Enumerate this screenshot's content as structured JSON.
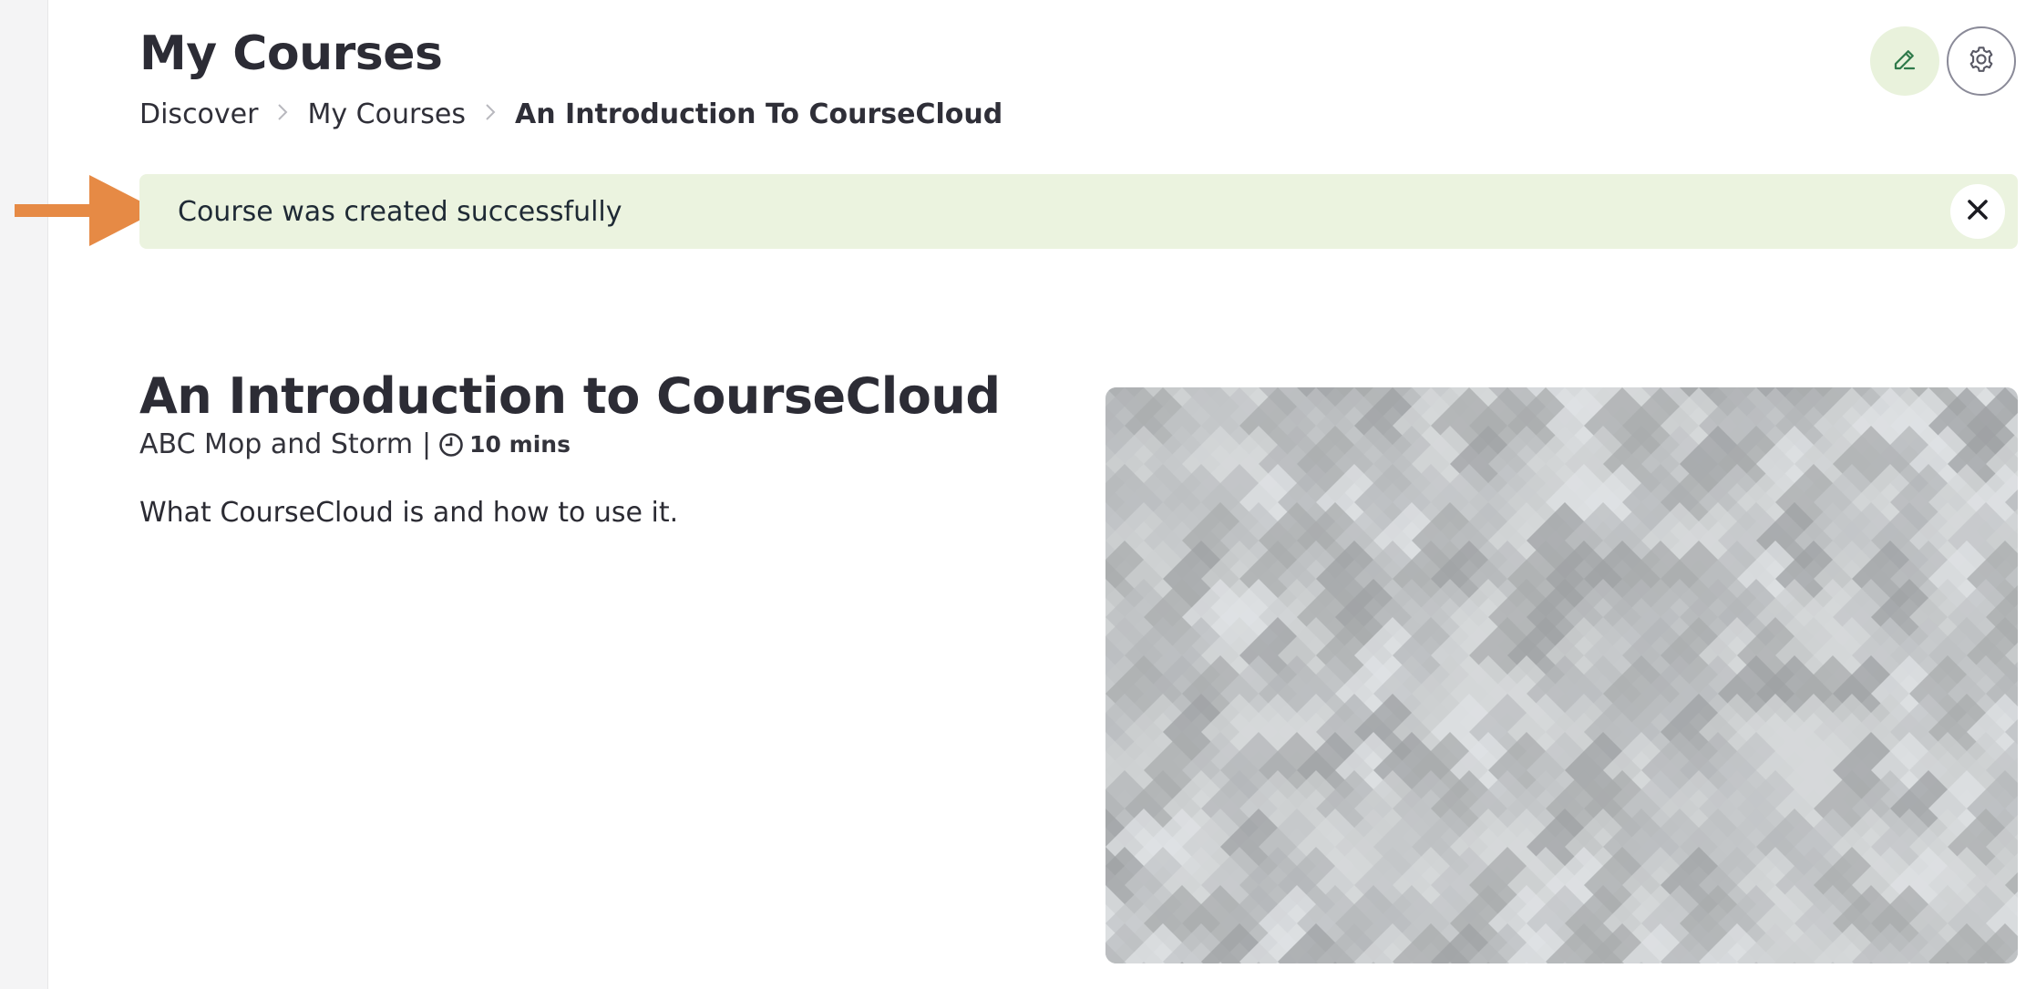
{
  "header": {
    "title": "My Courses",
    "edit_icon": "pencil-icon",
    "settings_icon": "gear-icon"
  },
  "breadcrumb": {
    "items": [
      "Discover",
      "My Courses",
      "An Introduction To CourseCloud"
    ]
  },
  "alert": {
    "message": "Course was created successfully",
    "close_icon": "close-icon",
    "color": "#ebf3df"
  },
  "annotation": {
    "arrow_color": "#e68a45"
  },
  "course": {
    "title": "An Introduction to CourseCloud",
    "author": "ABC Mop and Storm",
    "separator": "|",
    "duration": "10 mins",
    "description": "What CourseCloud is and how to use it."
  },
  "colors": {
    "accent_green": "#2f7a4a",
    "alert_bg": "#ebf3df",
    "arrow": "#e68a45"
  }
}
